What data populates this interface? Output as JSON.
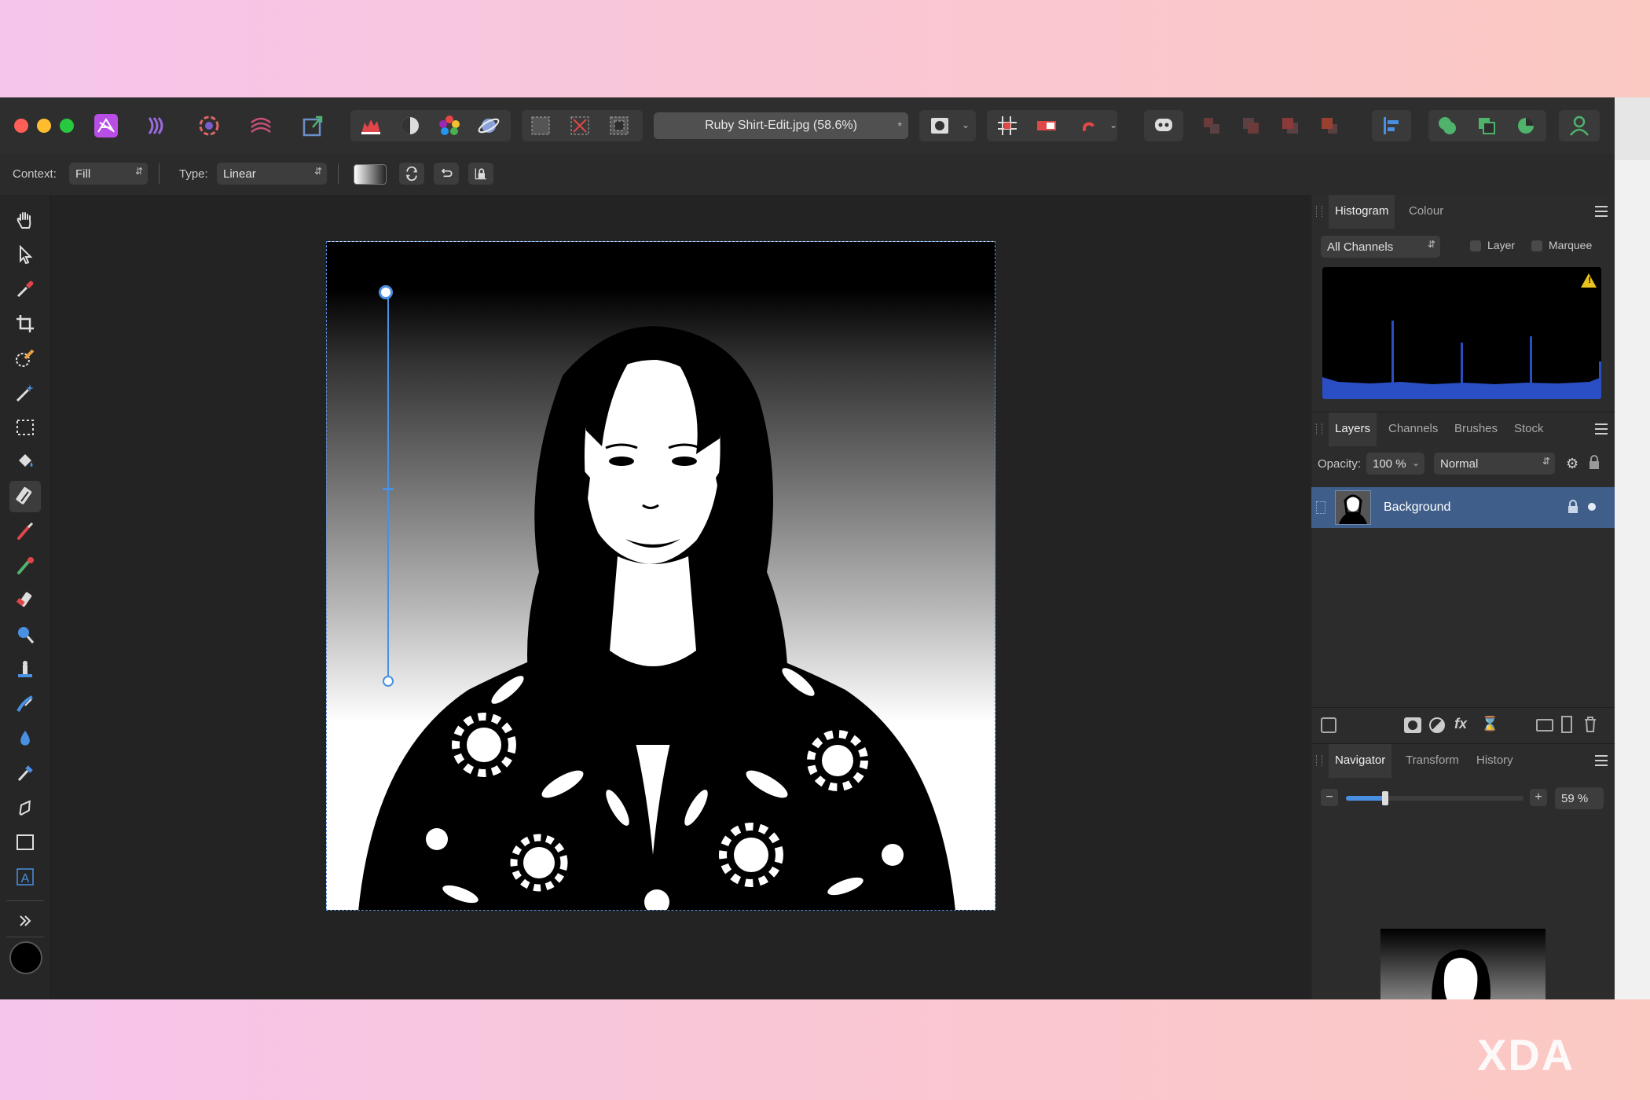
{
  "document": {
    "title": "Ruby Shirt-Edit.jpg (58.6%)",
    "close_glyph": "*"
  },
  "context_bar": {
    "context_label": "Context:",
    "context_value": "Fill",
    "type_label": "Type:",
    "type_value": "Linear"
  },
  "histogram_panel": {
    "tabs": [
      "Histogram",
      "Colour"
    ],
    "channel_value": "All Channels",
    "layer_label": "Layer",
    "marquee_label": "Marquee",
    "warning_glyph": "!"
  },
  "layers_panel": {
    "tabs": [
      "Layers",
      "Channels",
      "Brushes",
      "Stock"
    ],
    "opacity_label": "Opacity:",
    "opacity_value": "100 %",
    "blend_mode": "Normal",
    "layers": [
      {
        "name": "Background"
      }
    ]
  },
  "navigator_panel": {
    "tabs": [
      "Navigator",
      "Transform",
      "History"
    ],
    "zoom_value": "59 %",
    "zoom_fraction": 0.22
  },
  "watermark": {
    "text": "XDA"
  },
  "colors": {
    "accent": "#4a90e2",
    "selected_layer": "#3f5f8a",
    "personas": "#b84ee6"
  },
  "icons": {
    "tools": [
      "hand-icon",
      "move-icon",
      "color-picker-icon",
      "crop-icon",
      "selection-brush-icon",
      "flood-select-icon",
      "marquee-icon",
      "flood-fill-icon",
      "gradient-icon",
      "paint-brush-icon",
      "color-replacement-icon",
      "erase-brush-icon",
      "dodge-icon",
      "clone-icon",
      "smudge-icon",
      "blur-icon",
      "healing-icon",
      "pen-icon",
      "rectangle-icon",
      "text-icon"
    ]
  }
}
